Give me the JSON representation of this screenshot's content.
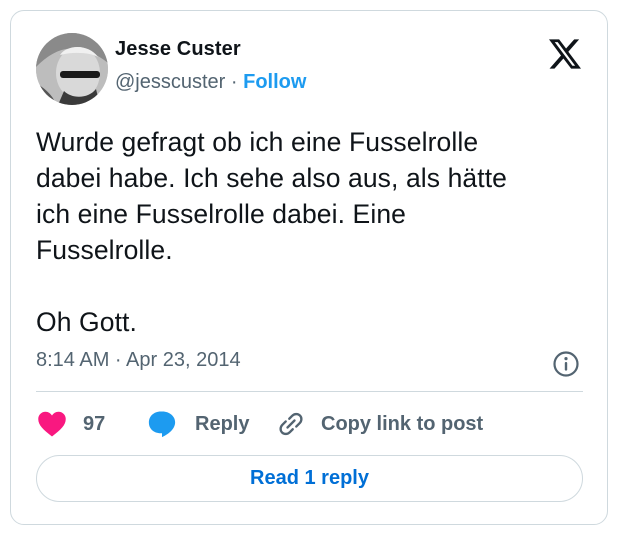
{
  "author": {
    "name": "Jesse Custer",
    "handle": "@jesscuster",
    "separator": " · ",
    "follow_label": "Follow"
  },
  "tweet": {
    "text": "Wurde gefragt ob ich eine Fusselrolle\ndabei habe. Ich sehe also aus, als hätte\nich eine Fusselrolle dabei. Eine\nFusselrolle.\n\nOh Gott.",
    "timestamp": "8:14 AM · Apr 23, 2014"
  },
  "actions": {
    "like_count": "97",
    "reply_label": "Reply",
    "copy_link_label": "Copy link to post"
  },
  "read_replies_label": "Read 1 reply",
  "icons": {
    "logo": "x-logo-icon",
    "info": "info-icon",
    "like": "heart-icon",
    "reply": "speech-bubble-icon",
    "copy": "link-icon"
  },
  "colors": {
    "accent": "#1d9bf0",
    "read_link": "#006fd6",
    "heart": "#f91880",
    "muted_text": "#536471",
    "border": "#cfd9de"
  }
}
